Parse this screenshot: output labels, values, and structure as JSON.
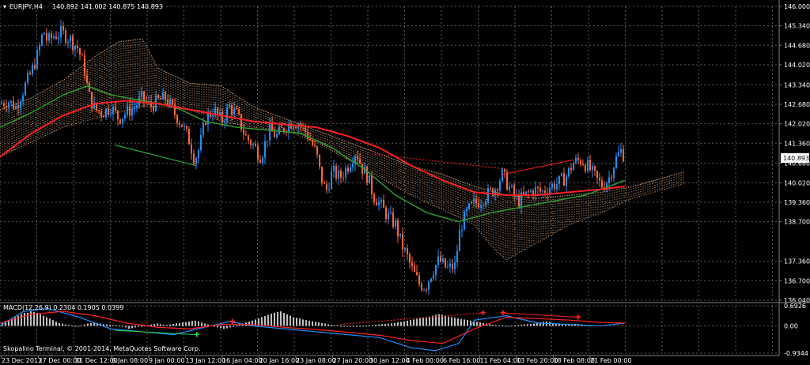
{
  "chart_data": {
    "type": "line",
    "main": {
      "symbol_label": "EURJPY,H4",
      "ohlc_label": "140.892 141.002 140.875 140.893",
      "price_ticks": [
        "146.000",
        "145.340",
        "144.680",
        "144.020",
        "143.340",
        "142.680",
        "142.020",
        "141.360",
        "140.680",
        "140.020",
        "139.360",
        "138.700",
        "137.360",
        "136.700",
        "136.040"
      ],
      "current_price": "140.893",
      "ylim": [
        136.04,
        146.0
      ],
      "price_path": [
        [
          0,
          142.7
        ],
        [
          10,
          142.8
        ],
        [
          20,
          142.6
        ],
        [
          30,
          143.2
        ],
        [
          40,
          143.8
        ],
        [
          48,
          144.4
        ],
        [
          55,
          145.2
        ],
        [
          60,
          144.8
        ],
        [
          68,
          145.0
        ],
        [
          78,
          145.1
        ],
        [
          88,
          144.9
        ],
        [
          98,
          144.6
        ],
        [
          106,
          144.0
        ],
        [
          112,
          143.0
        ],
        [
          120,
          142.5
        ],
        [
          130,
          142.4
        ],
        [
          140,
          142.6
        ],
        [
          150,
          142.2
        ],
        [
          160,
          142.4
        ],
        [
          170,
          142.6
        ],
        [
          180,
          142.9
        ],
        [
          190,
          142.6
        ],
        [
          200,
          142.8
        ],
        [
          210,
          142.9
        ],
        [
          220,
          142.4
        ],
        [
          230,
          142.0
        ],
        [
          240,
          141.4
        ],
        [
          246,
          140.8
        ],
        [
          252,
          141.2
        ],
        [
          260,
          142.2
        ],
        [
          270,
          142.5
        ],
        [
          280,
          142.1
        ],
        [
          290,
          142.6
        ],
        [
          300,
          142.3
        ],
        [
          310,
          141.6
        ],
        [
          320,
          141.3
        ],
        [
          330,
          140.9
        ],
        [
          340,
          141.8
        ],
        [
          350,
          141.6
        ],
        [
          360,
          141.9
        ],
        [
          370,
          142.1
        ],
        [
          380,
          142.0
        ],
        [
          390,
          141.6
        ],
        [
          400,
          141.0
        ],
        [
          405,
          140.3
        ],
        [
          412,
          139.7
        ],
        [
          420,
          140.4
        ],
        [
          430,
          140.2
        ],
        [
          440,
          140.6
        ],
        [
          450,
          141.1
        ],
        [
          458,
          140.5
        ],
        [
          465,
          140.2
        ],
        [
          472,
          139.6
        ],
        [
          480,
          139.3
        ],
        [
          490,
          138.9
        ],
        [
          500,
          138.6
        ],
        [
          508,
          137.9
        ],
        [
          515,
          137.5
        ],
        [
          522,
          137.0
        ],
        [
          530,
          136.6
        ],
        [
          538,
          136.5
        ],
        [
          546,
          137.0
        ],
        [
          555,
          137.4
        ],
        [
          565,
          137.1
        ],
        [
          575,
          137.2
        ],
        [
          582,
          138.5
        ],
        [
          590,
          139.0
        ],
        [
          598,
          139.3
        ],
        [
          606,
          139.4
        ],
        [
          615,
          139.6
        ],
        [
          625,
          139.8
        ],
        [
          635,
          140.3
        ],
        [
          645,
          139.8
        ],
        [
          655,
          139.4
        ],
        [
          665,
          139.6
        ],
        [
          675,
          139.8
        ],
        [
          685,
          139.7
        ],
        [
          695,
          139.9
        ],
        [
          705,
          140.0
        ],
        [
          715,
          140.2
        ],
        [
          725,
          140.7
        ],
        [
          735,
          140.8
        ],
        [
          745,
          140.5
        ],
        [
          755,
          140.1
        ],
        [
          762,
          139.9
        ],
        [
          770,
          140.2
        ],
        [
          778,
          140.8
        ],
        [
          785,
          141.1
        ],
        [
          790,
          140.9
        ]
      ],
      "ma_red": [
        [
          0,
          140.9
        ],
        [
          40,
          141.7
        ],
        [
          80,
          142.3
        ],
        [
          120,
          142.7
        ],
        [
          160,
          142.8
        ],
        [
          200,
          142.7
        ],
        [
          240,
          142.5
        ],
        [
          280,
          142.3
        ],
        [
          320,
          142.1
        ],
        [
          360,
          142.0
        ],
        [
          400,
          141.9
        ],
        [
          440,
          141.6
        ],
        [
          480,
          141.2
        ],
        [
          520,
          140.6
        ],
        [
          560,
          140.1
        ],
        [
          600,
          139.7
        ],
        [
          640,
          139.6
        ],
        [
          680,
          139.6
        ],
        [
          720,
          139.7
        ],
        [
          760,
          139.8
        ],
        [
          790,
          139.9
        ]
      ],
      "ma_green": [
        [
          0,
          141.9
        ],
        [
          40,
          142.4
        ],
        [
          80,
          143.0
        ],
        [
          110,
          143.3
        ],
        [
          140,
          143.0
        ],
        [
          180,
          142.8
        ],
        [
          220,
          142.6
        ],
        [
          260,
          142.1
        ],
        [
          300,
          141.9
        ],
        [
          340,
          141.8
        ],
        [
          380,
          141.7
        ],
        [
          420,
          141.2
        ],
        [
          460,
          140.5
        ],
        [
          500,
          139.6
        ],
        [
          540,
          139.0
        ],
        [
          580,
          138.7
        ],
        [
          620,
          139.0
        ],
        [
          660,
          139.2
        ],
        [
          700,
          139.4
        ],
        [
          740,
          139.6
        ],
        [
          790,
          140.1
        ]
      ],
      "cloud_top": [
        [
          0,
          142.5
        ],
        [
          40,
          142.9
        ],
        [
          80,
          143.5
        ],
        [
          120,
          144.3
        ],
        [
          150,
          144.8
        ],
        [
          180,
          144.9
        ],
        [
          200,
          143.9
        ],
        [
          240,
          143.4
        ],
        [
          280,
          143.3
        ],
        [
          320,
          142.6
        ],
        [
          360,
          142.2
        ],
        [
          400,
          141.8
        ],
        [
          440,
          141.4
        ],
        [
          480,
          141.0
        ],
        [
          520,
          140.6
        ],
        [
          560,
          140.3
        ],
        [
          600,
          139.9
        ],
        [
          640,
          139.6
        ],
        [
          680,
          139.5
        ],
        [
          720,
          139.6
        ],
        [
          760,
          139.7
        ],
        [
          800,
          139.9
        ],
        [
          840,
          140.2
        ],
        [
          866,
          140.4
        ]
      ],
      "cloud_bottom": [
        [
          0,
          140.9
        ],
        [
          40,
          141.4
        ],
        [
          80,
          141.9
        ],
        [
          120,
          142.2
        ],
        [
          150,
          142.4
        ],
        [
          180,
          142.6
        ],
        [
          200,
          142.6
        ],
        [
          240,
          142.5
        ],
        [
          280,
          142.1
        ],
        [
          320,
          141.9
        ],
        [
          360,
          141.8
        ],
        [
          400,
          141.4
        ],
        [
          440,
          140.8
        ],
        [
          480,
          140.2
        ],
        [
          520,
          139.6
        ],
        [
          560,
          139.1
        ],
        [
          600,
          138.6
        ],
        [
          620,
          137.9
        ],
        [
          640,
          137.4
        ],
        [
          680,
          138.0
        ],
        [
          720,
          138.6
        ],
        [
          760,
          139.0
        ],
        [
          800,
          139.5
        ],
        [
          840,
          139.8
        ],
        [
          866,
          140.0
        ]
      ]
    },
    "macd": {
      "label": "MACD(12,26,9) 0.2304 0.1905 0.0399",
      "ticks": [
        "0.6926",
        "0.00",
        "-0.9344"
      ],
      "ylim": [
        -0.9344,
        0.6926
      ],
      "histogram_step": 4,
      "histogram": [
        0.1,
        0.15,
        0.2,
        0.25,
        0.3,
        0.35,
        0.4,
        0.45,
        0.45,
        0.5,
        0.48,
        0.45,
        0.4,
        0.35,
        0.3,
        0.25,
        0.2,
        0.15,
        0.1,
        0.08,
        0.05,
        0.03,
        0.01,
        -0.02,
        0.0,
        0.02,
        0.05,
        0.08,
        0.1,
        0.12,
        0.1,
        0.08,
        0.06,
        0.05,
        0.04,
        0.03,
        0.02,
        0.01,
        -0.02,
        -0.05,
        -0.1,
        -0.08,
        -0.05,
        -0.03,
        -0.01,
        0.01,
        0.03,
        0.05,
        0.07,
        0.08,
        0.06,
        0.04,
        0.03,
        0.05,
        0.07,
        0.09,
        0.1,
        0.12,
        0.13,
        0.15,
        0.17,
        0.18,
        0.16,
        0.12,
        0.08,
        0.05,
        0.02,
        -0.02,
        -0.05,
        -0.08,
        -0.1,
        -0.08,
        -0.05,
        -0.02,
        0.02,
        0.05,
        0.08,
        0.12,
        0.15,
        0.18,
        0.22,
        0.26,
        0.3,
        0.34,
        0.38,
        0.42,
        0.45,
        0.48,
        0.5,
        0.45,
        0.4,
        0.35,
        0.3,
        0.28,
        0.25,
        0.22,
        0.2,
        0.18,
        0.16,
        0.14,
        0.12,
        0.1,
        0.08,
        0.06,
        0.04,
        0.02,
        0.01,
        0.0,
        -0.01,
        -0.02,
        -0.03,
        -0.03,
        -0.02,
        -0.01,
        0.0,
        0.01,
        0.02,
        0.03,
        0.04,
        0.05,
        0.06,
        0.07,
        0.08,
        0.09,
        0.1,
        0.12,
        0.14,
        0.16,
        0.18,
        0.2,
        0.22,
        0.24,
        0.26,
        0.28,
        0.3,
        0.32,
        0.35,
        0.38,
        0.4,
        0.38,
        0.35,
        0.32,
        0.3,
        0.28,
        0.26,
        0.24,
        0.22,
        0.2,
        0.18,
        0.16,
        0.14,
        0.12,
        0.1,
        0.08,
        0.06,
        0.04,
        0.03,
        0.02,
        0.01,
        0.0,
        0.0,
        0.01,
        0.02,
        0.03,
        0.04,
        0.05,
        0.06,
        0.07,
        0.08,
        0.1,
        0.12,
        0.14,
        0.15,
        0.13,
        0.1,
        0.08,
        0.06,
        0.05,
        0.04,
        0.05,
        0.06,
        0.07,
        0.06,
        0.05,
        0.04,
        0.03,
        0.02
      ],
      "signal_blue": [
        [
          0,
          0.0
        ],
        [
          30,
          0.5
        ],
        [
          60,
          0.6
        ],
        [
          100,
          0.3
        ],
        [
          140,
          -0.1
        ],
        [
          180,
          -0.2
        ],
        [
          220,
          -0.3
        ],
        [
          250,
          -0.1
        ],
        [
          290,
          0.15
        ],
        [
          320,
          0.0
        ],
        [
          360,
          -0.1
        ],
        [
          400,
          -0.2
        ],
        [
          440,
          -0.3
        ],
        [
          480,
          -0.4
        ],
        [
          520,
          -0.75
        ],
        [
          550,
          -0.85
        ],
        [
          580,
          -0.6
        ],
        [
          600,
          0.2
        ],
        [
          640,
          0.35
        ],
        [
          680,
          0.1
        ],
        [
          720,
          0.05
        ],
        [
          760,
          0.0
        ],
        [
          790,
          0.1
        ]
      ],
      "signal_red": [
        [
          0,
          0.1
        ],
        [
          40,
          0.4
        ],
        [
          80,
          0.5
        ],
        [
          120,
          0.35
        ],
        [
          160,
          0.1
        ],
        [
          200,
          -0.05
        ],
        [
          240,
          -0.1
        ],
        [
          280,
          0.05
        ],
        [
          320,
          0.05
        ],
        [
          360,
          -0.05
        ],
        [
          400,
          -0.12
        ],
        [
          440,
          -0.22
        ],
        [
          480,
          -0.32
        ],
        [
          520,
          -0.5
        ],
        [
          560,
          -0.6
        ],
        [
          600,
          -0.1
        ],
        [
          640,
          0.3
        ],
        [
          680,
          0.25
        ],
        [
          720,
          0.2
        ],
        [
          760,
          0.12
        ],
        [
          790,
          0.1
        ]
      ]
    },
    "x_ticks": [
      "23 Dec 2013",
      "27 Dec 00:00",
      "31 Dec 12:00",
      "6 Jan 08:00",
      "9 Jan 00:00",
      "13 Jan 12:00",
      "16 Jan 04:00",
      "20 Jan 16:00",
      "23 Jan 08:00",
      "27 Jan 20:00",
      "30 Jan 12:00",
      "4 Feb 00:00",
      "6 Feb 16:00",
      "11 Feb 04:00",
      "13 Feb 20:00",
      "18 Feb 08:00",
      "21 Feb 00:00"
    ],
    "copyright": "Skopalino Terminal, © 2001-2014, MetaQuotes Software Corp.",
    "colors": {
      "background": "#000000",
      "grid": "#5a5a5a",
      "bull": "#1e90ff",
      "bear": "#ff6633",
      "ma_red": "#ff2020",
      "ma_green": "#2e9e2e",
      "cloud": "#d8a67a",
      "macd_hist": "#c0c0c0",
      "macd_blue": "#1e90ff",
      "macd_red": "#ff2020",
      "divergence": "#ff2020",
      "divergence_green": "#2ecc40"
    }
  }
}
